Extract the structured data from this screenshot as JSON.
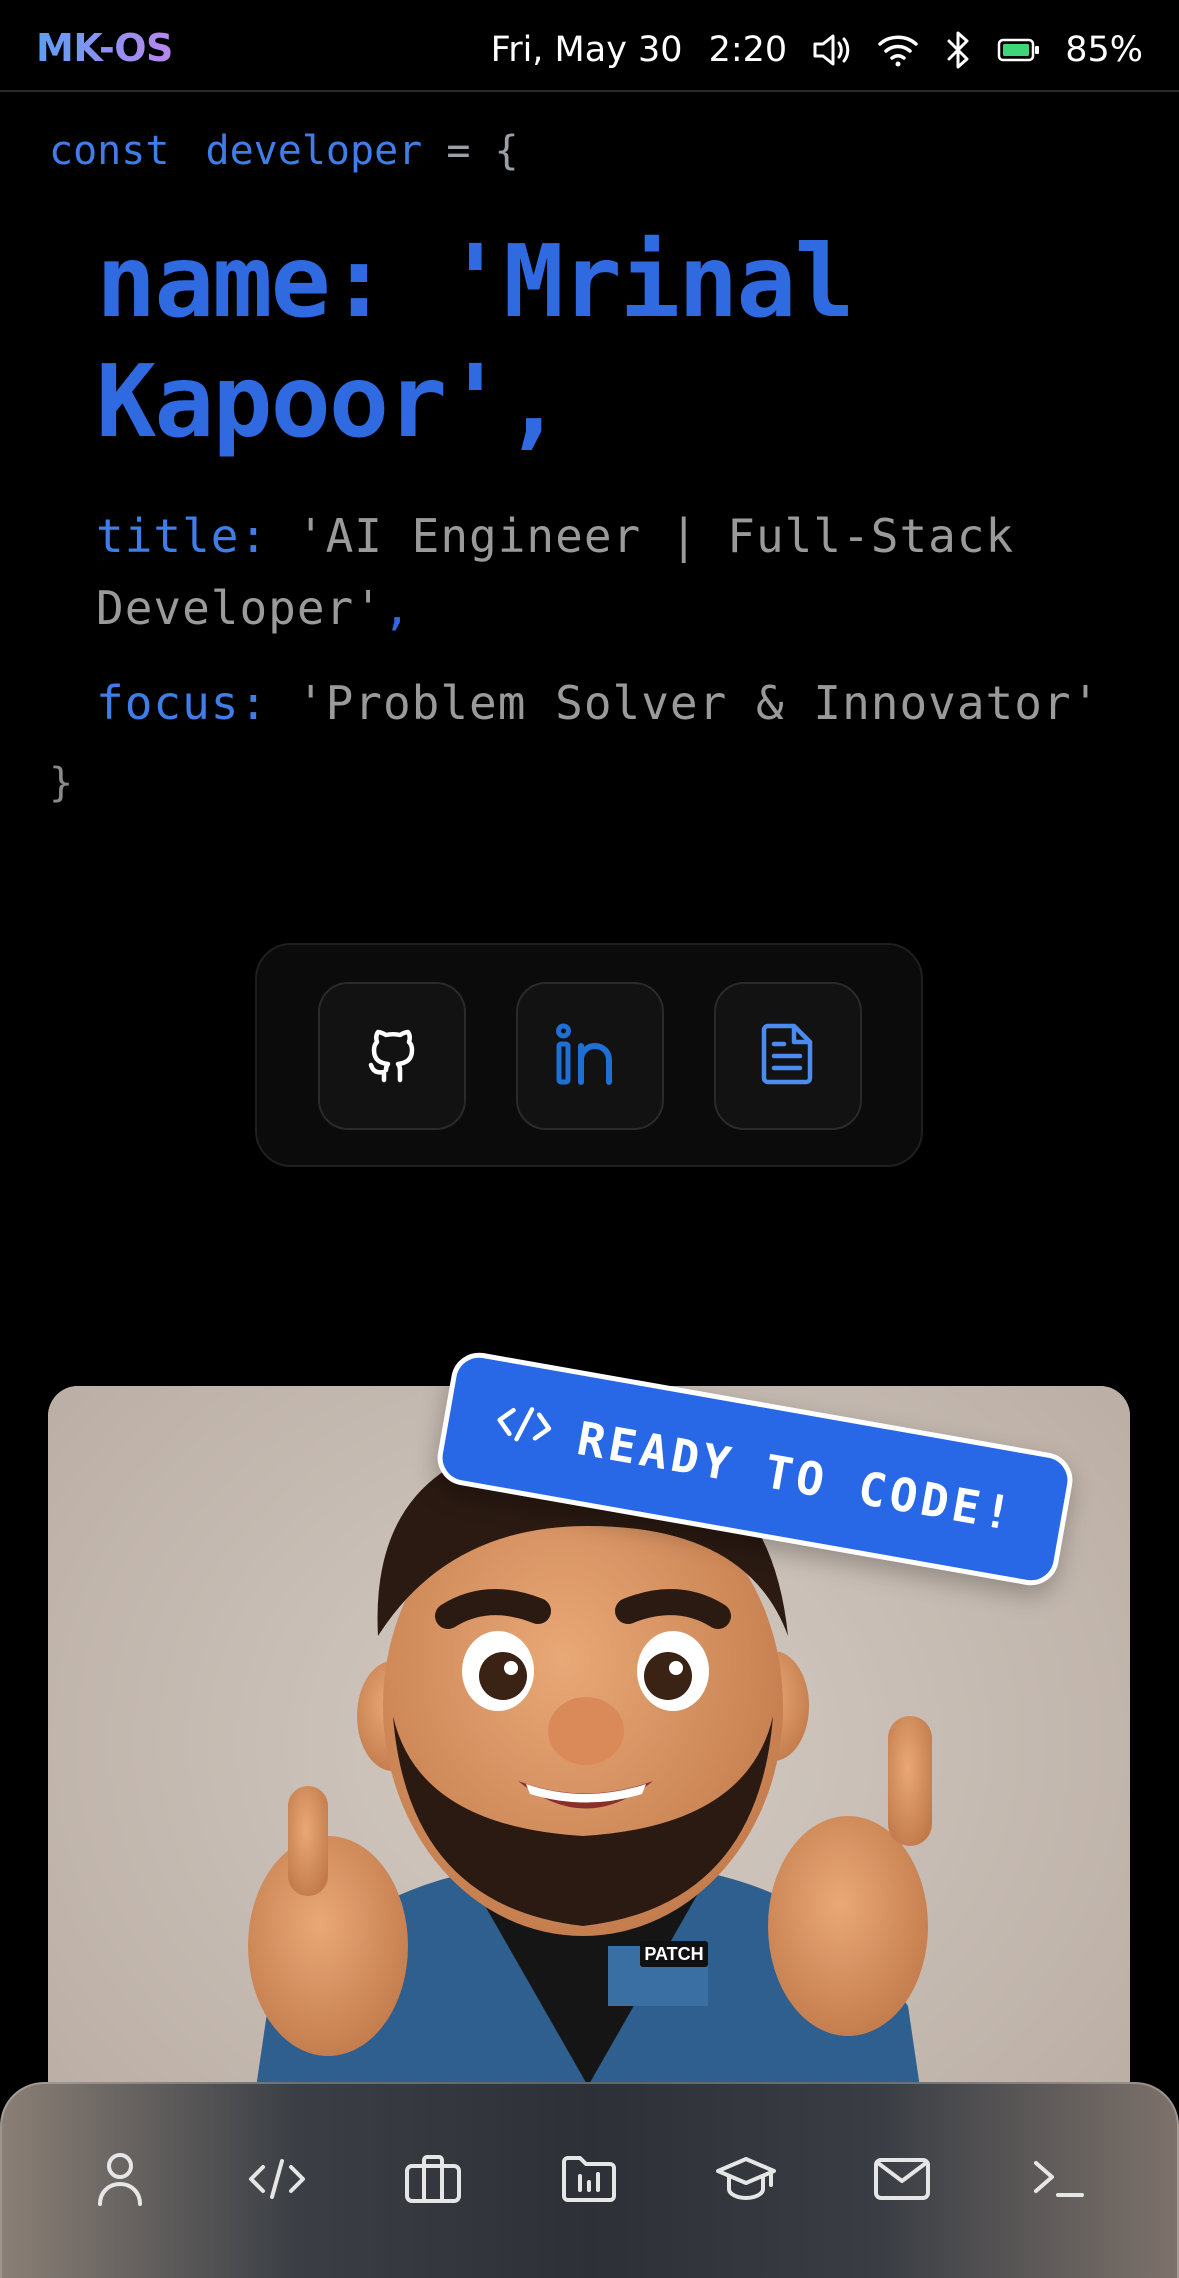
{
  "status_bar": {
    "brand": "MK-OS",
    "date": "Fri, May 30",
    "time": "2:20",
    "battery": "85%",
    "icons": [
      "volume-icon",
      "wifi-icon",
      "bluetooth-icon",
      "battery-icon"
    ]
  },
  "code": {
    "open": {
      "keyword": "const",
      "identifier": "developer",
      "rest": " = {"
    },
    "name": {
      "key": "name:",
      "value": "'Mrinal Kapoor'",
      "comma": ","
    },
    "title": {
      "key": "title:",
      "value": "'AI Engineer | Full-Stack Developer'",
      "comma": ","
    },
    "focus": {
      "key": "focus:",
      "value": "'Problem Solver & Innovator'"
    },
    "close": "}"
  },
  "social": {
    "items": [
      {
        "icon": "github-icon"
      },
      {
        "icon": "linkedin-icon"
      },
      {
        "icon": "resume-document-icon"
      }
    ]
  },
  "hero": {
    "badge_icon": "code-icon",
    "badge_text": "READY TO CODE!",
    "patch_text": "PATCH"
  },
  "dock": {
    "items": [
      "user-icon",
      "code-icon",
      "briefcase-icon",
      "folder-icon",
      "graduation-cap-icon",
      "mail-icon",
      "terminal-icon"
    ]
  },
  "colors": {
    "accent": "#2f6ae0",
    "badge": "#2867e6",
    "background": "#000000"
  }
}
